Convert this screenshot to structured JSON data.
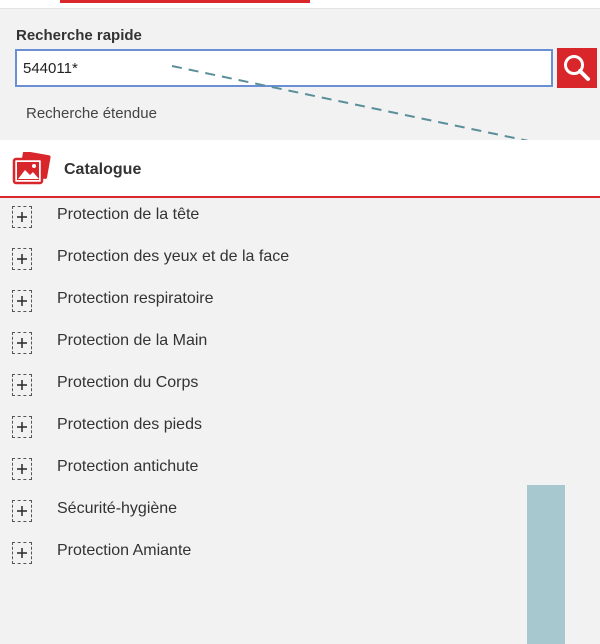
{
  "search": {
    "label": "Recherche rapide",
    "value": "544011*",
    "advanced_link": "Recherche étendue"
  },
  "catalog": {
    "title": "Catalogue",
    "items": [
      {
        "label": "Protection de la tête"
      },
      {
        "label": "Protection des yeux et de la face"
      },
      {
        "label": "Protection respiratoire"
      },
      {
        "label": "Protection de la Main"
      },
      {
        "label": "Protection du Corps"
      },
      {
        "label": "Protection des pieds"
      },
      {
        "label": "Protection antichute"
      },
      {
        "label": "Sécurité-hygiène"
      },
      {
        "label": "Protection Amiante"
      }
    ]
  },
  "colors": {
    "accent": "#d9262b",
    "input_border": "#6b8fd6",
    "annotation_line": "#5a8f9a",
    "scroll_block": "#a8c8d0"
  },
  "icons": {
    "search_button": "magnifier-icon",
    "catalog": "image-gallery-icon",
    "tree_toggle": "plus-icon"
  }
}
